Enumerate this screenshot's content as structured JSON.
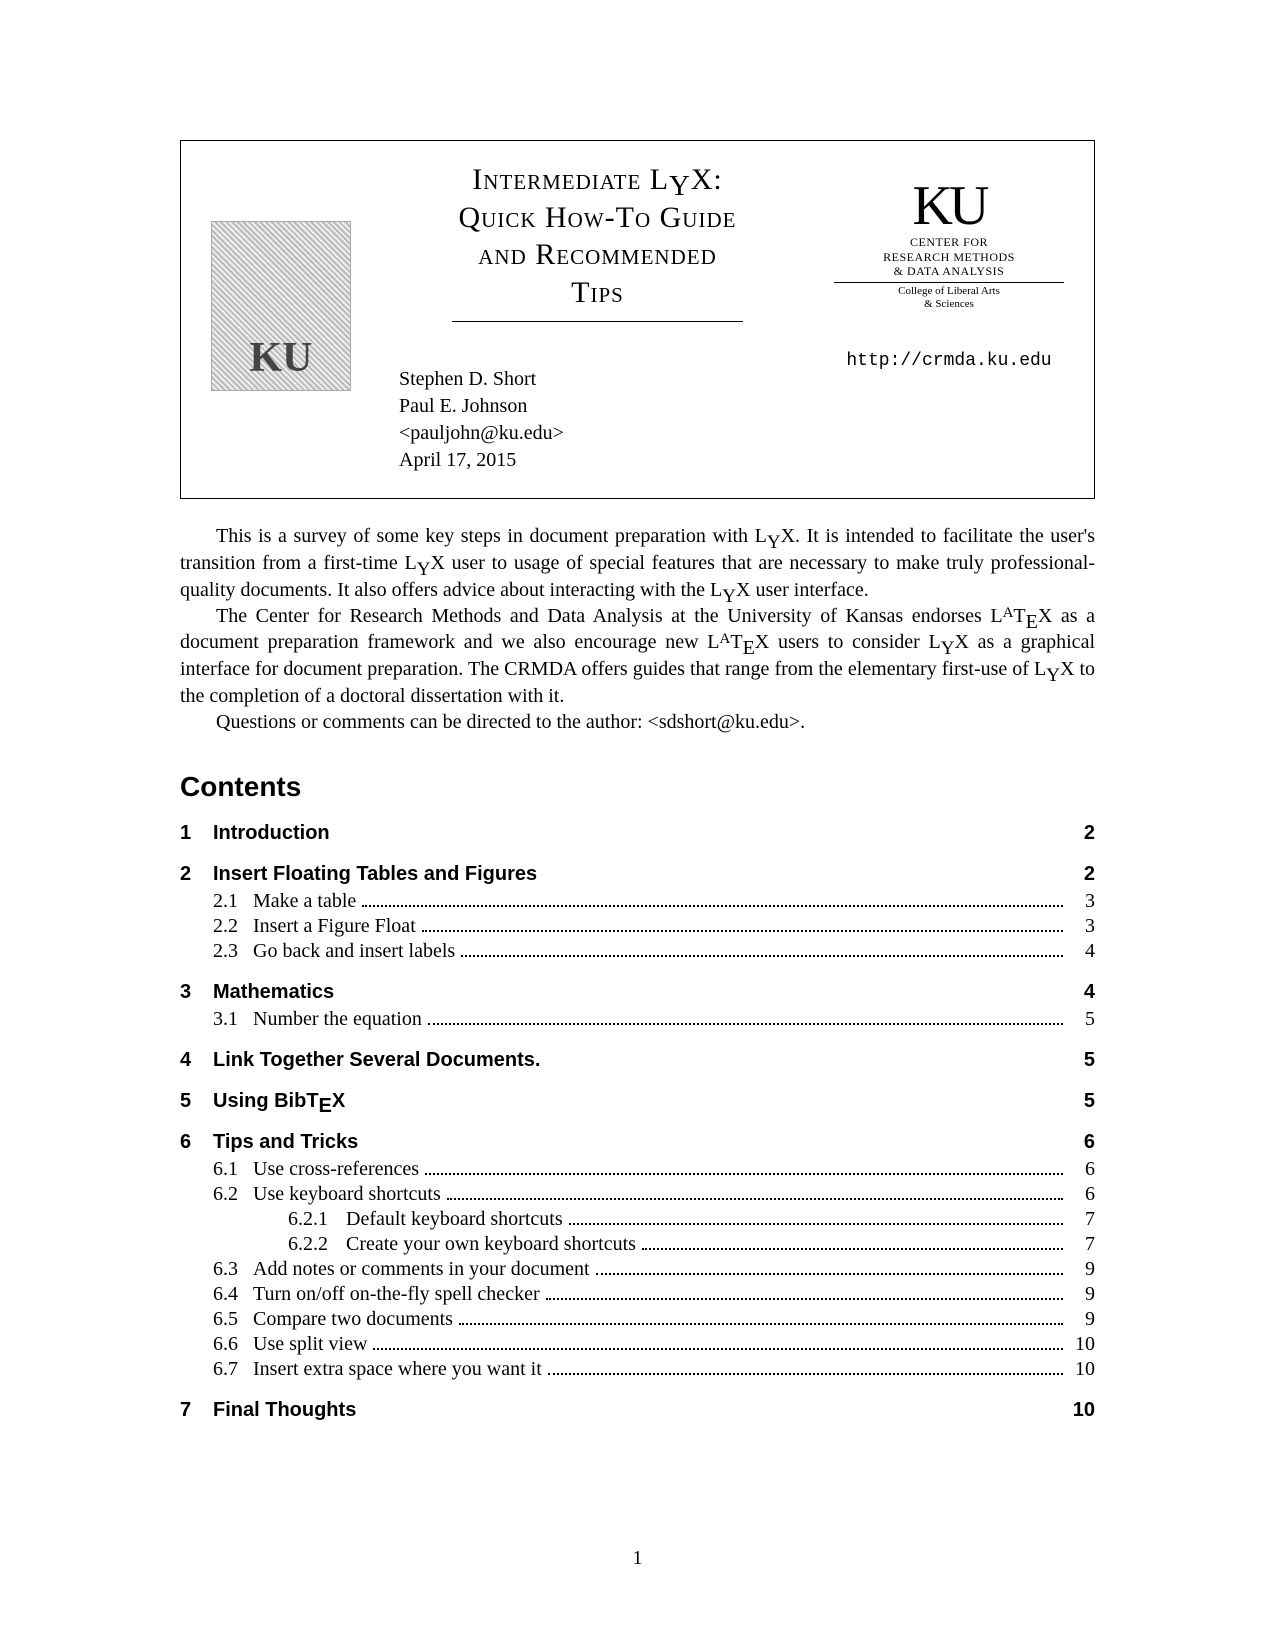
{
  "header": {
    "logo_text": "KU",
    "title_line1": "Intermediate L",
    "title_line1_y": "Y",
    "title_line1_end": "X:",
    "title_line2": "Quick How-To Guide",
    "title_line3": "and Recommended",
    "title_line4": "Tips",
    "author1": "Stephen D. Short",
    "author2": "Paul E. Johnson",
    "email": "<pauljohn@ku.edu>",
    "date": "April 17, 2015",
    "ku_big": "KU",
    "ku_sub1": "CENTER FOR",
    "ku_sub2": "RESEARCH METHODS",
    "ku_sub3": "& DATA ANALYSIS",
    "ku_college1": "College of Liberal Arts",
    "ku_college2": "& Sciences",
    "url": "http://crmda.ku.edu"
  },
  "intro": {
    "p1a": "This is a survey of some key steps in document preparation with L",
    "p1b": "X. It is intended to facilitate the user's transition from a first-time L",
    "p1c": "X user to usage of special features that are necessary to make truly professional-quality documents. It also offers advice about interacting with the L",
    "p1d": "X user interface.",
    "p2a": "The Center for Research Methods and Data Analysis at the University of Kansas endorses L",
    "p2b": "X as a document preparation framework and we also encourage new L",
    "p2c": "X users to consider L",
    "p2d": "X as a graphical interface for document preparation. The CRMDA offers guides that range from the elementary first-use of L",
    "p2e": "X to the completion of a doctoral dissertation with it.",
    "p3": "Questions or comments can be directed to the author: <sdshort@ku.edu>."
  },
  "contents_heading": "Contents",
  "toc": [
    {
      "level": "sec",
      "num": "1",
      "title": "Introduction",
      "page": "2",
      "dots": false
    },
    {
      "level": "sec",
      "num": "2",
      "title": "Insert Floating Tables and Figures",
      "page": "2",
      "dots": false
    },
    {
      "level": "sub",
      "num": "2.1",
      "title": "Make a table",
      "page": "3",
      "dots": true
    },
    {
      "level": "sub",
      "num": "2.2",
      "title": "Insert a Figure Float",
      "page": "3",
      "dots": true
    },
    {
      "level": "sub",
      "num": "2.3",
      "title": "Go back and insert labels",
      "page": "4",
      "dots": true
    },
    {
      "level": "sec",
      "num": "3",
      "title": "Mathematics",
      "page": "4",
      "dots": false
    },
    {
      "level": "sub",
      "num": "3.1",
      "title": "Number the equation",
      "page": "5",
      "dots": true
    },
    {
      "level": "sec",
      "num": "4",
      "title": "Link Together Several Documents.",
      "page": "5",
      "dots": false
    },
    {
      "level": "sec",
      "num": "5",
      "title": "Using BibT[E]X",
      "page": "5",
      "dots": false,
      "bibtex": true
    },
    {
      "level": "sec",
      "num": "6",
      "title": "Tips and Tricks",
      "page": "6",
      "dots": false
    },
    {
      "level": "sub",
      "num": "6.1",
      "title": "Use cross-references",
      "page": "6",
      "dots": true
    },
    {
      "level": "sub",
      "num": "6.2",
      "title": "Use keyboard shortcuts",
      "page": "6",
      "dots": true
    },
    {
      "level": "subsub",
      "num": "6.2.1",
      "title": "Default keyboard shortcuts",
      "page": "7",
      "dots": true
    },
    {
      "level": "subsub",
      "num": "6.2.2",
      "title": "Create your own keyboard shortcuts",
      "page": "7",
      "dots": true
    },
    {
      "level": "sub",
      "num": "6.3",
      "title": "Add notes or comments in your document",
      "page": "9",
      "dots": true
    },
    {
      "level": "sub",
      "num": "6.4",
      "title": "Turn on/off on-the-fly spell checker",
      "page": "9",
      "dots": true
    },
    {
      "level": "sub",
      "num": "6.5",
      "title": "Compare two documents",
      "page": "9",
      "dots": true
    },
    {
      "level": "sub",
      "num": "6.6",
      "title": "Use split view",
      "page": "10",
      "dots": true
    },
    {
      "level": "sub",
      "num": "6.7",
      "title": "Insert extra space where you want it",
      "page": "10",
      "dots": true
    },
    {
      "level": "sec",
      "num": "7",
      "title": "Final Thoughts",
      "page": "10",
      "dots": false
    }
  ],
  "page_number": "1"
}
